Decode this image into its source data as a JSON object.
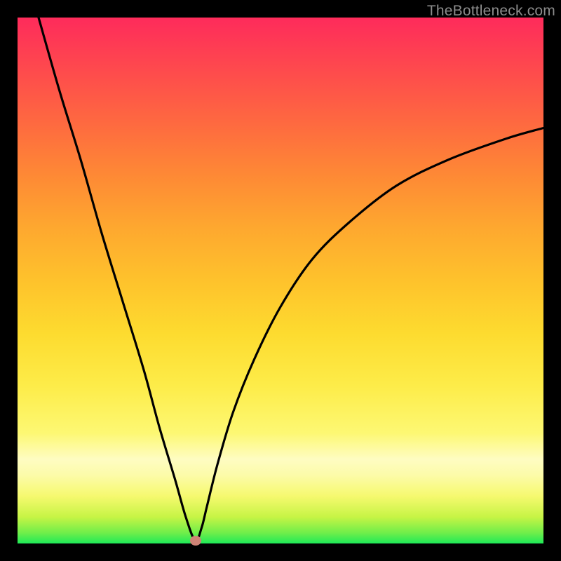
{
  "watermark": "TheBottleneck.com",
  "chart_data": {
    "type": "line",
    "title": "",
    "xlabel": "",
    "ylabel": "",
    "xlim": [
      0,
      100
    ],
    "ylim": [
      0,
      100
    ],
    "series": [
      {
        "name": "bottleneck-curve",
        "x": [
          4,
          8,
          12,
          16,
          20,
          24,
          27,
          30,
          32,
          33.8,
          35,
          36,
          38,
          41,
          45,
          50,
          56,
          63,
          72,
          82,
          93,
          100
        ],
        "y": [
          100,
          86,
          73,
          59,
          46,
          33,
          22,
          12,
          5,
          0.5,
          3,
          7,
          15,
          25,
          35,
          45,
          54,
          61,
          68,
          73,
          77,
          79
        ]
      }
    ],
    "marker": {
      "x": 33.8,
      "y": 0.5,
      "color": "#cf8376"
    },
    "background_gradient": {
      "top": "#fe2b5b",
      "middle": "#fdec49",
      "bottom": "#1eea57"
    }
  }
}
